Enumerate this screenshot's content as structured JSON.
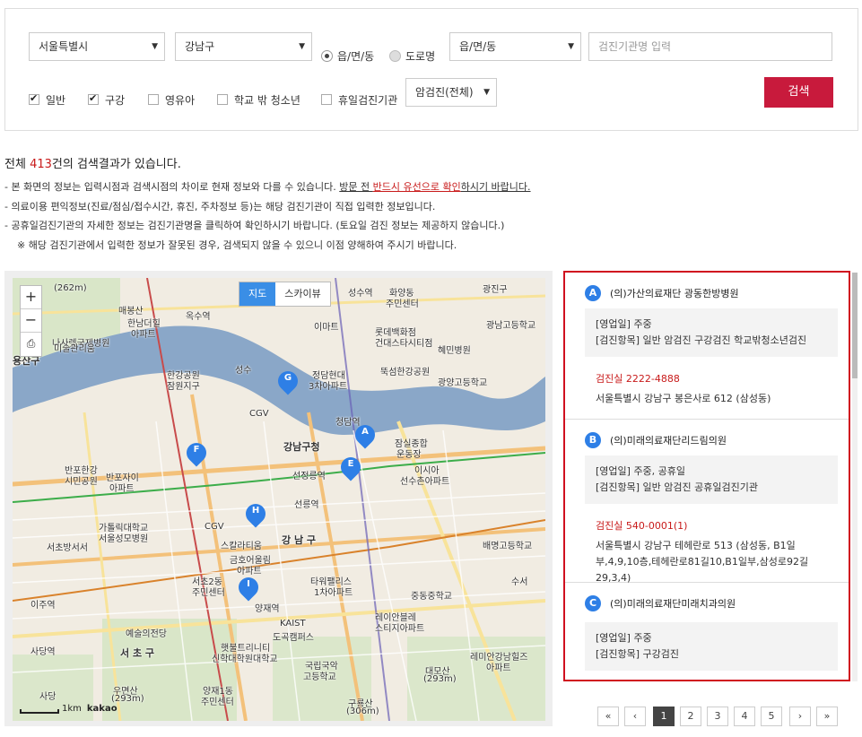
{
  "search": {
    "sido": "서울특별시",
    "sigungu": "강남구",
    "addr_type_options": [
      "읍/면/동",
      "도로명"
    ],
    "dong": "읍/면/동",
    "name_placeholder": "검진기관명 입력",
    "checks": [
      {
        "label": "일반",
        "checked": true
      },
      {
        "label": "구강",
        "checked": true
      },
      {
        "label": "영유아",
        "checked": false
      },
      {
        "label": "학교 밖 청소년",
        "checked": false
      },
      {
        "label": "휴일검진기관",
        "checked": false
      }
    ],
    "cancer_select": "암검진(전체)",
    "button": "검색"
  },
  "result": {
    "prefix": "전체 ",
    "count": "413",
    "suffix": "건의 검색결과가 있습니다.",
    "notice1_a": "- 본 화면의 정보는 입력시점과 검색시점의 차이로 현재 정보와 다를 수 있습니다.  ",
    "notice1_b": "방문 전 ",
    "notice1_c": "반드시 유선으로 확인",
    "notice1_d": "하시기 바랍니다.",
    "notice2": "- 의료이용 편익정보(진료/점심/접수시간, 휴진, 주차정보 등)는 해당 검진기관이 직접 입력한 정보입니다.",
    "notice3": "- 공휴일검진기관의 자세한 정보는 검진기관명을 클릭하여 확인하시기 바랍니다. (토요일 검진 정보는 제공하지 않습니다.)",
    "notice4": "※ 해당 검진기관에서 입력한 정보가 잘못된 경우, 검색되지 않을 수 있으니 이점 양해하여 주시기 바랍니다."
  },
  "map": {
    "type_map": "지도",
    "type_sky": "스카이뷰",
    "zoom_in": "+",
    "zoom_out": "−",
    "print": "⎙",
    "scale": "1km",
    "logo": "kakao",
    "labels": [
      "(262m)",
      "매봉산",
      "한남더힐",
      "아파트",
      "옥수역",
      "화양동",
      "주민센터",
      "성수역",
      "광진구",
      "이마트",
      "롯데백화점",
      "건대스타시티점",
      "혜민병원",
      "광남고등학교",
      "나사렛국제병원",
      "미술관리움",
      "용산구",
      "한강공원",
      "잠원지구",
      "성수",
      "정담현대",
      "3차아파트",
      "뚝섬한강공원",
      "광양고등학교",
      "CGV",
      "강남구청",
      "청담역",
      "잠실종합",
      "운동장",
      "반포한강",
      "시민공원",
      "선정릉역",
      "이시아",
      "선수촌아파트",
      "반포자이",
      "아파트",
      "선릉역",
      "가톨릭대학교",
      "서울성모병원",
      "CGV",
      "스칼라티움",
      "강 남 구",
      "배명고등학교",
      "서초방서서",
      "금호어울림",
      "아파트",
      "서초2동",
      "주민센터",
      "타워팰리스",
      "1차아파트",
      "중동중학교",
      "수서",
      "이주역",
      "양재역",
      "레이안블레",
      "스티지아파트",
      "사당역",
      "예술의전당",
      "KAIST",
      "도곡캠퍼스",
      "서 초 구",
      "햇불트리니티",
      "신학대학원대학교",
      "국립국악",
      "고등학교",
      "레미안강남힐즈",
      "아파트",
      "사당",
      "우면산",
      "(293m)",
      "양재1동",
      "주민센터",
      "대모산",
      "(293m)",
      "구룡산",
      "(306m)"
    ]
  },
  "list": [
    {
      "letter": "A",
      "name": "(의)가산의료재단 광동한방병원",
      "hours": "[영업일] 주중",
      "items": "[검진항목] 일반 암검진 구강검진 학교밖청소년검진",
      "tel": "검진실  2222-4888",
      "addr": "서울특별시 강남구 봉은사로 612 (삼성동)"
    },
    {
      "letter": "B",
      "name": "(의)미래의료재단리드림의원",
      "hours": "[영업일] 주중, 공휴일",
      "items": "[검진항목] 일반 암검진 공휴일검진기관",
      "tel": "검진실  540-0001(1)",
      "addr": "서울특별시 강남구 테헤란로 513 (삼성동, B1일부,4,9,10층,테헤란로81길10,B1일부,삼성로92길29,3,4)"
    },
    {
      "letter": "C",
      "name": "(의)미래의료재단미래치과의원",
      "hours": "[영업일] 주중",
      "items": "[검진항목] 구강검진"
    }
  ],
  "pager": {
    "first": "«",
    "prev": "‹",
    "pages": [
      "1",
      "2",
      "3",
      "4",
      "5"
    ],
    "current": "1",
    "next": "›",
    "last": "»"
  },
  "colors": {
    "accent_red": "#c81a3c",
    "pin_blue": "#2e7fe6",
    "highlight_border": "#d0101f",
    "river": "#8aa7c8"
  },
  "pins": [
    "A",
    "E",
    "F",
    "G",
    "H",
    "I"
  ]
}
